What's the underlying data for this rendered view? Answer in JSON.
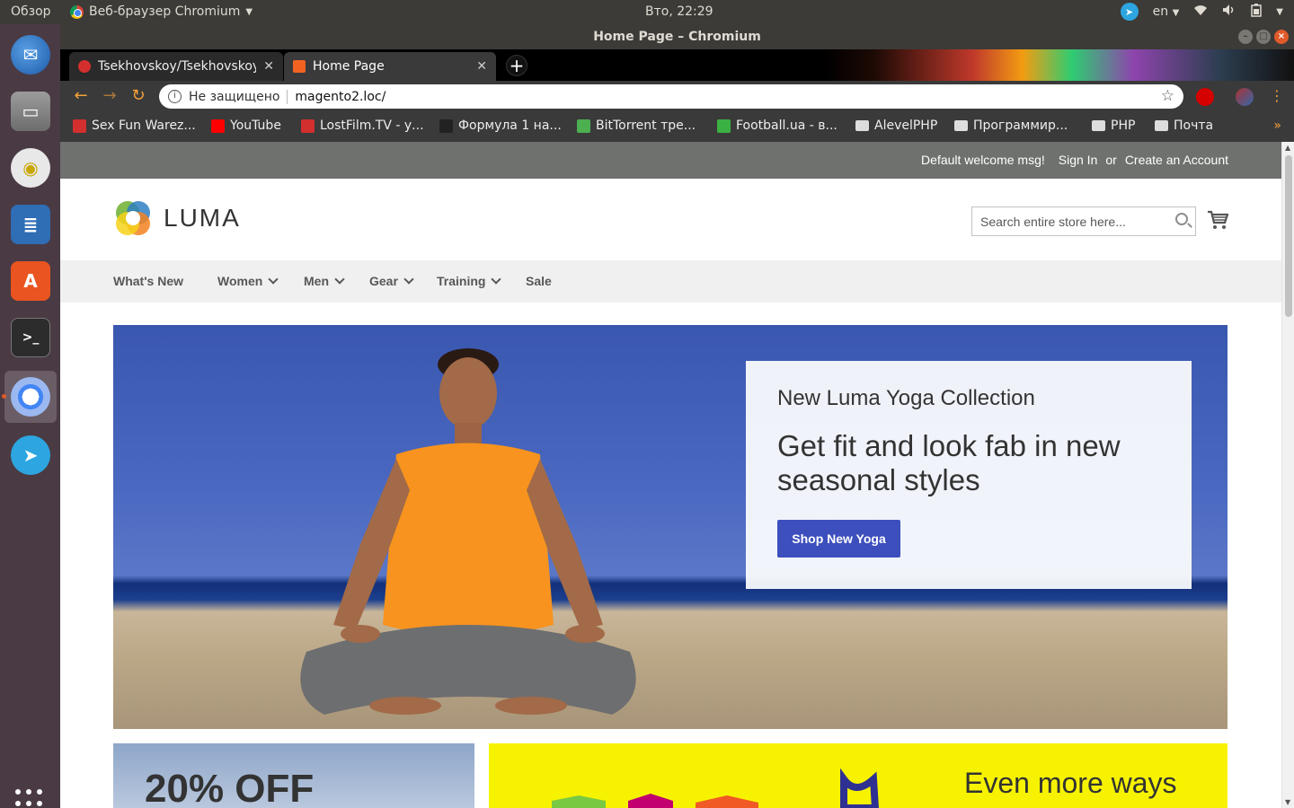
{
  "os": {
    "overview_label": "Обзор",
    "app_menu_label": "Веб-браузер Chromium",
    "clock": "Вто, 22:29",
    "keyboard_layout": "en"
  },
  "launcher": {
    "items": [
      "thunderbird-mail",
      "files",
      "rhythmbox",
      "libreoffice-writer",
      "ubuntu-software",
      "terminal",
      "chromium",
      "telegram"
    ],
    "apps_grid": "show-applications"
  },
  "window": {
    "title": "Home Page – Chromium"
  },
  "tabs": [
    {
      "label": "Tsekhovskoy/Tsekhovskoy",
      "active": false
    },
    {
      "label": "Home Page",
      "active": true
    }
  ],
  "omnibox": {
    "security_text": "Не защищено",
    "url": "magento2.loc/"
  },
  "bookmarks": [
    {
      "label": "Sex Fun Warez...",
      "color": "#d32f2f"
    },
    {
      "label": "YouTube",
      "color": "#ff0000"
    },
    {
      "label": "LostFilm.TV - у...",
      "color": "#d32f2f"
    },
    {
      "label": "Формула 1 на...",
      "color": "#222222"
    },
    {
      "label": "BitTorrent тре...",
      "color": "#4caf50"
    },
    {
      "label": "Football.ua - в...",
      "color": "#3bb143"
    },
    {
      "label": "AlevelPHP",
      "color": "folder"
    },
    {
      "label": "Программир...",
      "color": "folder"
    },
    {
      "label": "PHP",
      "color": "folder"
    },
    {
      "label": "Почта",
      "color": "folder"
    }
  ],
  "store": {
    "welcome": "Default welcome msg!",
    "sign_in": "Sign In",
    "or": "or",
    "create_account": "Create an Account",
    "logo_text": "LUMA",
    "search_placeholder": "Search entire store here...",
    "nav": [
      "What's New",
      "Women",
      "Men",
      "Gear",
      "Training",
      "Sale"
    ],
    "hero": {
      "subtitle": "New Luma Yoga Collection",
      "headline": "Get fit and look fab in new seasonal styles",
      "button": "Shop New Yoga"
    },
    "promo_left": "20% OFF",
    "promo_right": "Even more ways"
  },
  "colors": {
    "accent_button": "#3d4fbd",
    "panel_header": "#6e716e",
    "promo_yellow": "#f7f300"
  }
}
